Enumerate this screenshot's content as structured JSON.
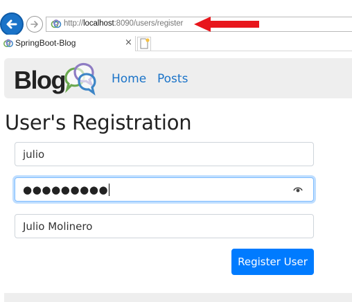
{
  "browser": {
    "url_prefix": "http://",
    "url_host": "localhost",
    "url_rest": ":8090/users/register",
    "tab_title": "SpringBoot-Blog",
    "tab_close": "×"
  },
  "navbar": {
    "brand": "Blog",
    "links": [
      "Home",
      "Posts"
    ],
    "link_color": "#1a73c8"
  },
  "page": {
    "title": "User's Registration"
  },
  "form": {
    "username_value": "julio",
    "password_mask": "●●●●●●●●●",
    "fullname_value": "Julio Molinero",
    "submit_label": "Register User",
    "accent": "#007bff"
  },
  "annotation": {
    "arrow_color": "#e8161c",
    "arrow_icon": "red-arrow-left"
  }
}
